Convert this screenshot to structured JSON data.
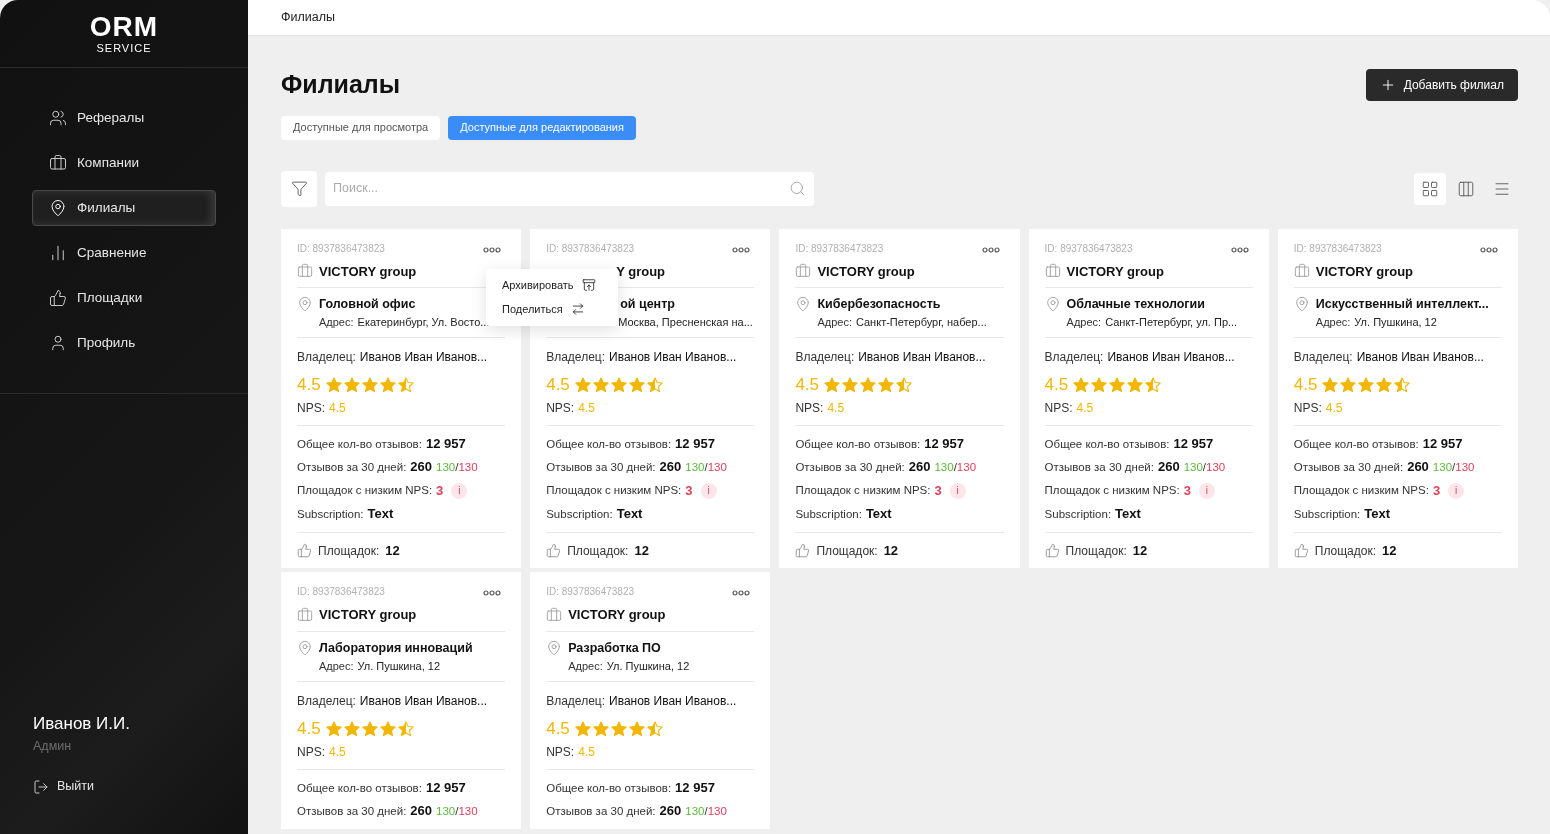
{
  "logo": {
    "title": "ORM",
    "subtitle": "SERVICE"
  },
  "nav": [
    {
      "label": "Рефералы",
      "selected": false
    },
    {
      "label": "Компании",
      "selected": false
    },
    {
      "label": "Филиалы",
      "selected": true
    },
    {
      "label": "Сравнение",
      "selected": false
    },
    {
      "label": "Площадки",
      "selected": false
    },
    {
      "label": "Профиль",
      "selected": false
    }
  ],
  "user": {
    "name": "Иванов И.И.",
    "role": "Админ",
    "logout": "Выйти"
  },
  "breadcrumb": "Филиалы",
  "title": "Филиалы",
  "add_button": "Добавить филиал",
  "tabs": [
    {
      "label": "Доступные для просмотра",
      "selected": false
    },
    {
      "label": "Доступные для редактирования",
      "selected": true
    }
  ],
  "search": {
    "placeholder": "Поиск..."
  },
  "view_modes": [
    {
      "kind": "grid",
      "selected": true
    },
    {
      "kind": "columns",
      "selected": false
    },
    {
      "kind": "list",
      "selected": false
    }
  ],
  "menu": [
    {
      "label": "Архивировать"
    },
    {
      "label": "Поделиться"
    }
  ],
  "cards": [
    {
      "id": "ID: 8937836473823",
      "company": "VICTORY group",
      "branch": "Головной офис",
      "address_label": "Адрес:",
      "address": "Екатеринбург, Ул. Восто...",
      "owner_label": "Владелец:",
      "owner": "Иванов Иван Иванов...",
      "rating": "4.5",
      "stars": 4.5,
      "nps_label": "NPS:",
      "nps": "4.5",
      "total_label": "Общее кол-во отзывов:",
      "total": "12 957",
      "recent_label": "Отзывов за 30 дней:",
      "recent": "260",
      "positive": "130",
      "slash": "/",
      "negative": "130",
      "low_label": "Площадок с низким NPS:",
      "low": "3",
      "info": "i",
      "sub_label": "Subscription:",
      "sub": "Text",
      "sites_label": "Площадок:",
      "sites": "12",
      "menu_open": true
    },
    {
      "id": "ID: 8937836473823",
      "company": "Y group",
      "branch": "ой центр",
      "address": "Москва, Пресненская на...",
      "owner_label": "Владелец:",
      "owner": "Иванов Иван Иванов...",
      "rating": "4.5",
      "stars": 4.5,
      "nps_label": "NPS:",
      "nps": "4.5",
      "total_label": "Общее кол-во отзывов:",
      "total": "12 957",
      "recent_label": "Отзывов за 30 дней:",
      "recent": "260",
      "positive": "130",
      "slash": "/",
      "negative": "130",
      "low_label": "Площадок с низким NPS:",
      "low": "3",
      "info": "i",
      "sub_label": "Subscription:",
      "sub": "Text",
      "sites_label": "Площадок:",
      "sites": "12",
      "covered": true
    },
    {
      "id": "ID: 8937836473823",
      "company": "VICTORY group",
      "branch": "Кибербезопасность",
      "address_label": "Адрес:",
      "address": "Санкт-Петербург, набер...",
      "owner_label": "Владелец:",
      "owner": "Иванов Иван Иванов...",
      "rating": "4.5",
      "stars": 4.5,
      "nps_label": "NPS:",
      "nps": "4.5",
      "total_label": "Общее кол-во отзывов:",
      "total": "12 957",
      "recent_label": "Отзывов за 30 дней:",
      "recent": "260",
      "positive": "130",
      "slash": "/",
      "negative": "130",
      "low_label": "Площадок с низким NPS:",
      "low": "3",
      "info": "i",
      "sub_label": "Subscription:",
      "sub": "Text",
      "sites_label": "Площадок:",
      "sites": "12"
    },
    {
      "id": "ID: 8937836473823",
      "company": "VICTORY group",
      "branch": "Облачные технологии",
      "address_label": "Адрес:",
      "address": "Санкт-Петербург, ул. Пр...",
      "owner_label": "Владелец:",
      "owner": "Иванов Иван Иванов...",
      "rating": "4.5",
      "stars": 4.5,
      "nps_label": "NPS:",
      "nps": "4.5",
      "total_label": "Общее кол-во отзывов:",
      "total": "12 957",
      "recent_label": "Отзывов за 30 дней:",
      "recent": "260",
      "positive": "130",
      "slash": "/",
      "negative": "130",
      "low_label": "Площадок с низким NPS:",
      "low": "3",
      "info": "i",
      "sub_label": "Subscription:",
      "sub": "Text",
      "sites_label": "Площадок:",
      "sites": "12"
    },
    {
      "id": "ID: 8937836473823",
      "company": "VICTORY group",
      "branch": "Искусственный интеллект...",
      "address_label": "Адрес:",
      "address": "Ул. Пушкина, 12",
      "owner_label": "Владелец:",
      "owner": "Иванов Иван Иванов...",
      "rating": "4.5",
      "stars": 4.5,
      "nps_label": "NPS:",
      "nps": "4.5",
      "total_label": "Общее кол-во отзывов:",
      "total": "12 957",
      "recent_label": "Отзывов за 30 дней:",
      "recent": "260",
      "positive": "130",
      "slash": "/",
      "negative": "130",
      "low_label": "Площадок с низким NPS:",
      "low": "3",
      "info": "i",
      "sub_label": "Subscription:",
      "sub": "Text",
      "sites_label": "Площадок:",
      "sites": "12"
    },
    {
      "id": "ID: 8937836473823",
      "company": "VICTORY group",
      "branch": "Лаборатория инноваций",
      "address_label": "Адрес:",
      "address": "Ул. Пушкина, 12",
      "owner_label": "Владелец:",
      "owner": "Иванов Иван Иванов...",
      "rating": "4.5",
      "stars": 4.5,
      "nps_label": "NPS:",
      "nps": "4.5",
      "total_label": "Общее кол-во отзывов:",
      "total": "12 957",
      "recent_label": "Отзывов за 30 дней:",
      "recent": "260",
      "positive": "130",
      "slash": "/",
      "negative": "130"
    },
    {
      "id": "ID: 8937836473823",
      "company": "VICTORY group",
      "branch": "Разработка ПО",
      "address_label": "Адрес:",
      "address": "Ул. Пушкина, 12",
      "owner_label": "Владелец:",
      "owner": "Иванов Иван Иванов...",
      "rating": "4.5",
      "stars": 4.5,
      "nps_label": "NPS:",
      "nps": "4.5",
      "total_label": "Общее кол-во отзывов:",
      "total": "12 957",
      "recent_label": "Отзывов за 30 дней:",
      "recent": "260",
      "positive": "130",
      "slash": "/",
      "negative": "130"
    }
  ]
}
